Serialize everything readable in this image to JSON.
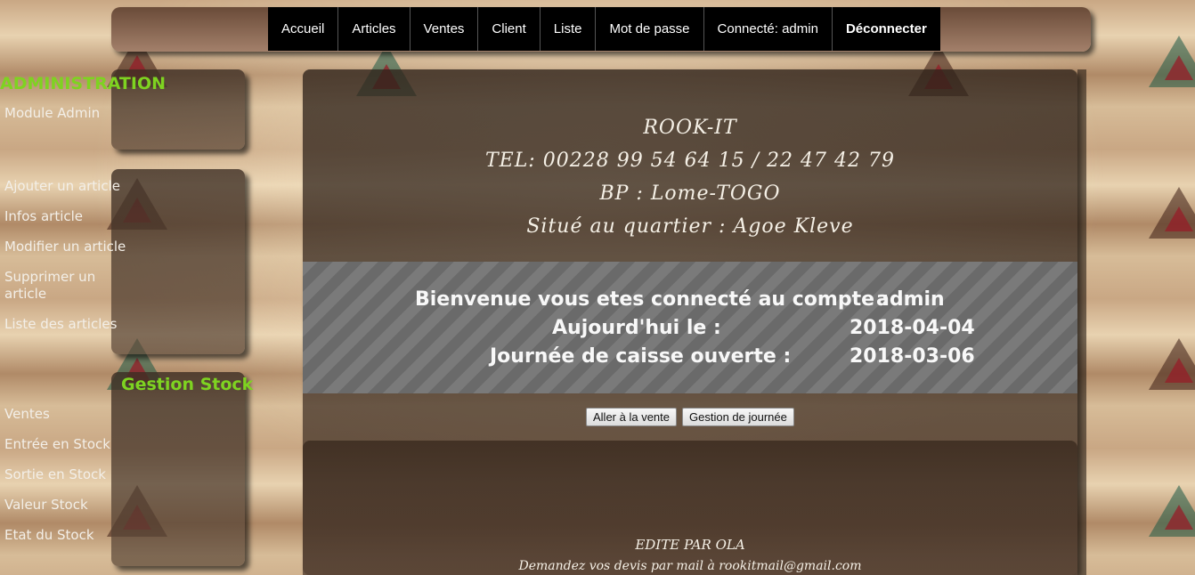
{
  "nav": {
    "items": [
      "Accueil",
      "Articles",
      "Ventes",
      "Client",
      "Liste",
      "Mot de passe",
      "Connecté: admin",
      "Déconnecter"
    ]
  },
  "sidebar": {
    "admin_title": "ADMINISTRATION",
    "admin_links": [
      "Module Admin"
    ],
    "article_links": [
      "Ajouter un article",
      "Infos article",
      "Modifier un article",
      "Supprimer un article",
      "Liste des articles"
    ],
    "stock_title": "Gestion Stock",
    "stock_links": [
      "Ventes",
      "Entrée en Stock",
      "Sortie en Stock",
      "Valeur Stock",
      "Etat du Stock"
    ]
  },
  "header": {
    "company": "ROOK-IT",
    "tel": "TEL: 00228 99 54 64 15 / 22 47 42 79",
    "bp": "BP :  Lome-TOGO",
    "address": "Situé au quartier : Agoe Kleve"
  },
  "welcome": {
    "account_label": "Bienvenue vous etes connecté au compte :",
    "account_value": "admin",
    "today_label": "Aujourd'hui le :",
    "today_value": "2018-04-04",
    "session_label": "Journée de caisse ouverte :",
    "session_value": "2018-03-06"
  },
  "buttons": {
    "go_sale": "Aller à la vente",
    "day_management": "Gestion de journée"
  },
  "footer": {
    "edited_by": "EDITE PAR OLA",
    "contact": "Demandez vos devis par mail à rookitmail@gmail.com"
  },
  "colors": {
    "accent_green": "#7ed321",
    "nav_bg": "#000000"
  }
}
